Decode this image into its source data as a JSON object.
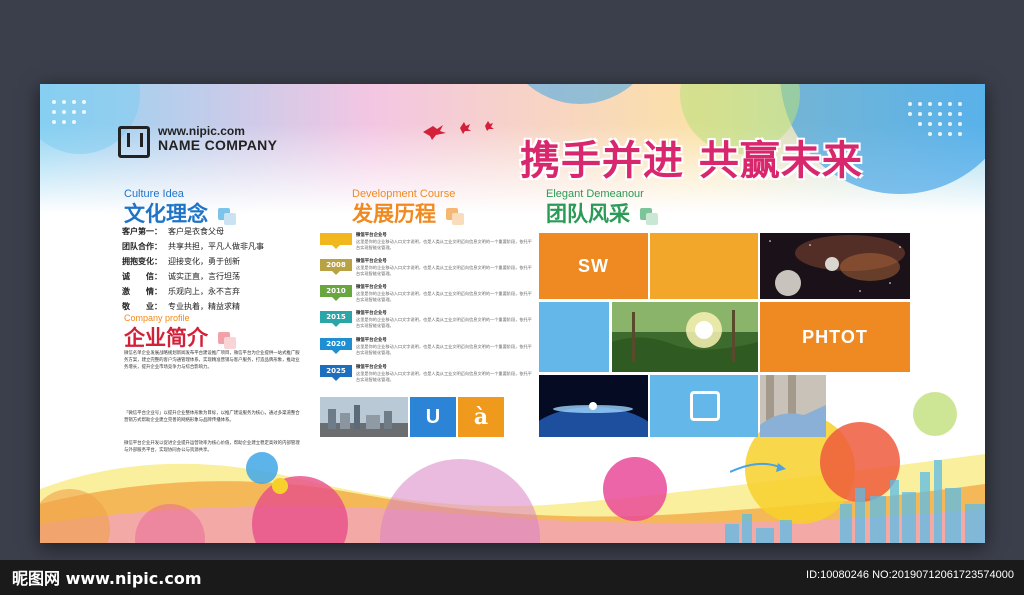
{
  "brand": {
    "site": "www.nipic.com",
    "company": "NAME COMPANY",
    "logo_icon": "nipic-logo-icon"
  },
  "headline": "携手并进 共赢未来",
  "culture": {
    "en": "Culture Idea",
    "title": "文化理念",
    "items": [
      {
        "k": "客户第一：",
        "v": "客户是衣食父母"
      },
      {
        "k": "团队合作：",
        "v": "共享共担，平凡人做非凡事"
      },
      {
        "k": "拥抱变化：",
        "v": "迎接变化，勇于创新"
      },
      {
        "k": "诚　　信：",
        "v": "诚实正直，言行坦荡"
      },
      {
        "k": "激　　情：",
        "v": "乐观向上，永不言弃"
      },
      {
        "k": "敬　　业：",
        "v": "专业执着，精益求精"
      }
    ]
  },
  "profile": {
    "en": "Company profile",
    "title": "企业简介",
    "p1": "微信名单企业发展战略规划新闻发布平台建设推广项目，微信平台为企业提供一站式推广服务方案，建立完整的客户沟通管理体系，实现精准营销与客户服务，打造品牌形象，推动业务增长，提升企业市场竞争力与综合影响力。",
    "p2": "「微信平台企业号」以提升企业整体形象为目标，以推广建设服务为核心，通过多渠道整合营销方式帮助企业建立完善的网络形象与品牌传播体系。",
    "p3": "微信平台企业开发以促进企业提升运营效率为核心价值，帮助企业建立稳定高效的内部管理与外部服务平台，实现协同办公与资源共享。"
  },
  "development": {
    "en": "Development Course",
    "title": "发展历程",
    "items": [
      {
        "year": "",
        "title": "微信平台企业号",
        "text": "这里是你的企业移动入口文字说明，也是人类从工业文明迈向信息文明的一个重要阶段，依托平台实现智能化管理。"
      },
      {
        "year": "2008",
        "title": "微信平台企业号",
        "text": "这里是你的企业移动入口文字说明，也是人类从工业文明迈向信息文明的一个重要阶段，依托平台实现智能化管理。"
      },
      {
        "year": "2010",
        "title": "微信平台企业号",
        "text": "这里是你的企业移动入口文字说明，也是人类从工业文明迈向信息文明的一个重要阶段，依托平台实现智能化管理。"
      },
      {
        "year": "2015",
        "title": "微信平台企业号",
        "text": "这里是你的企业移动入口文字说明，也是人类从工业文明迈向信息文明的一个重要阶段，依托平台实现智能化管理。"
      },
      {
        "year": "2020",
        "title": "微信平台企业号",
        "text": "这里是你的企业移动入口文字说明，也是人类从工业文明迈向信息文明的一个重要阶段，依托平台实现智能化管理。"
      },
      {
        "year": "2025",
        "title": "微信平台企业号",
        "text": "这里是你的企业移动入口文字说明，也是人类从工业文明迈向信息文明的一个重要阶段，依托平台实现智能化管理。"
      }
    ],
    "tiles": {
      "u": "U",
      "a": "à"
    }
  },
  "team": {
    "en": "Elegant Demeanour",
    "title": "团队风采",
    "tile_sw": "SW",
    "tile_photo": "PHTOT"
  },
  "colors": {
    "orange": "#ef8a22",
    "light_blue": "#64b5e8",
    "pink": "#d8276d"
  },
  "footer": {
    "watermark": "昵图网 www.nipic.com",
    "id": "ID:10080246 NO:20190712061723574000"
  }
}
